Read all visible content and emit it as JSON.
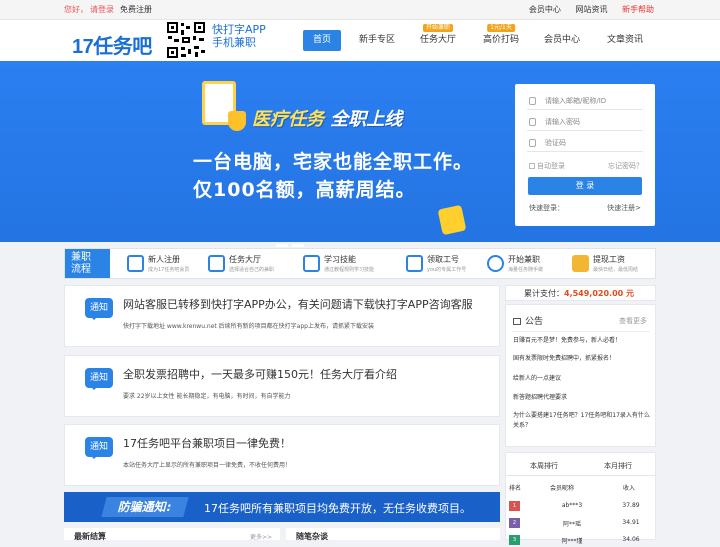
{
  "topbar": {
    "greeting": "您好，",
    "login": "请登录",
    "register": "免费注册",
    "links": [
      "会员中心",
      "网站资讯"
    ],
    "help": "新手帮助"
  },
  "header": {
    "logo": "17任务吧",
    "app_line1": "快打字APP",
    "app_line2": "手机兼职"
  },
  "nav": [
    {
      "label": "首页",
      "badge": ""
    },
    {
      "label": "新手专区",
      "badge": ""
    },
    {
      "label": "任务大厅",
      "badge": "开始兼职"
    },
    {
      "label": "高价打码",
      "badge": "1元/1天"
    },
    {
      "label": "会员中心",
      "badge": ""
    },
    {
      "label": "文章资讯",
      "badge": ""
    }
  ],
  "banner": {
    "headline_a": "医疗任务",
    "headline_b": " 全职上线",
    "line2": "一台电脑，宅家也能全职工作。",
    "line3": "仅100名额，高薪周结。"
  },
  "login": {
    "user_placeholder": "请输入邮箱/昵称/ID",
    "pass_placeholder": "请输入密码",
    "captcha_placeholder": "验证码",
    "auto": "自动登录",
    "forgot": "忘记密码？",
    "submit": "登 录",
    "quick": "快速登录：",
    "quick_reg": "快速注册>"
  },
  "process": {
    "label_1": "兼职",
    "label_2": "流程",
    "steps": [
      {
        "title": "新人注册",
        "sub": "成为17任务吧会员"
      },
      {
        "title": "任务大厅",
        "sub": "选择适合自己的兼职"
      },
      {
        "title": "学习技能",
        "sub": "通过教程规则学习技能"
      },
      {
        "title": "领取工号",
        "sub": "you的专属工作号"
      },
      {
        "title": "开始兼职",
        "sub": "海量任务随手做"
      },
      {
        "title": "提现工资",
        "sub": "最快日结，最低周结"
      }
    ]
  },
  "notices": [
    {
      "tag": "通知",
      "title": "网站客服已转移到快打字APP办公，有关问题请下载快打字APP咨询客服",
      "body": "快打字下载地址 www.krenwu.net 后续所有新的项目都在快打字app上发布，请抓紧下载安装"
    },
    {
      "tag": "通知",
      "title": "全职发票招聘中，一天最多可赚150元！任务大厅看介绍",
      "body": "要求 22岁以上女性 能长期稳定，有电脑，有时间，有自学能力"
    },
    {
      "tag": "通知",
      "title": "17任务吧平台兼职项目一律免费！",
      "body": "本站任务大厅上显示的所有兼职项目一律免费，不收任何费用！"
    }
  ],
  "fraud": {
    "tag": "防骗通知:",
    "message": "17任务吧所有兼职项目均免费开放，无任务收费项目。"
  },
  "bottom": {
    "left": "最新结算",
    "right": "随笔杂谈",
    "more": "更多>>"
  },
  "side": {
    "total_label": "累计支付：",
    "total_value": "4,549,020.00 元",
    "notice_title": "公告",
    "notice_more": "查看更多",
    "notice_items": [
      "日赚百元不是梦！免费参与，新人必看！",
      "国有发票限时免费招聘中，抓紧报名！",
      "给新人的一点建议",
      "新答题招聘代理要求",
      "为什么要搭建17任务吧？17任务吧和17录入有什么关系？"
    ],
    "tabs": [
      "本周排行",
      "本月排行"
    ],
    "rank_headers": [
      "排名",
      "会员昵称",
      "收入"
    ],
    "rank_rows": [
      {
        "n": "1",
        "user": "ab***3",
        "money": "37.89",
        "color": "#d9534f"
      },
      {
        "n": "2",
        "user": "阿**瑶",
        "money": "34.91",
        "color": "#7b5ea8"
      },
      {
        "n": "3",
        "user": "阿***瑾",
        "money": "34.06",
        "color": "#2a9d6e"
      }
    ]
  }
}
